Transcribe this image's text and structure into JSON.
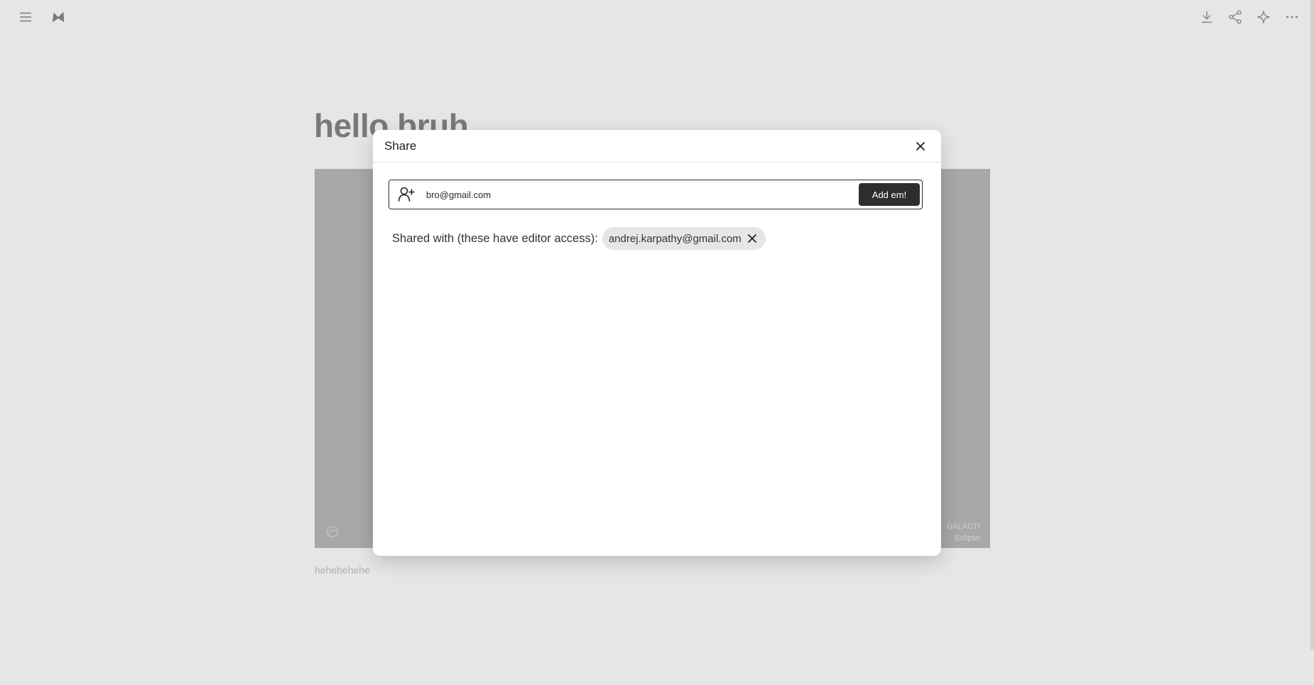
{
  "document": {
    "title": "hello bruh",
    "caption": "hehehehehe",
    "hero_watermark_line1": "GALACTI",
    "hero_watermark_line2": "Eclipse"
  },
  "toolbar": {
    "left_icons": [
      "menu-icon",
      "app-logo-icon"
    ],
    "right_icons": [
      "download-icon",
      "share-icon",
      "sparkle-icon",
      "more-icon"
    ]
  },
  "share_dialog": {
    "title": "Share",
    "invite_input_value": "bro@gmail.com",
    "add_button_label": "Add em!",
    "shared_label": "Shared with (these have editor access):",
    "shared_users": [
      "andrej.karpathy@gmail.com"
    ]
  },
  "colors": {
    "overlay": "#c8c8c8",
    "button_dark": "#2d2d2d",
    "chip_bg": "#e6e6e6"
  }
}
